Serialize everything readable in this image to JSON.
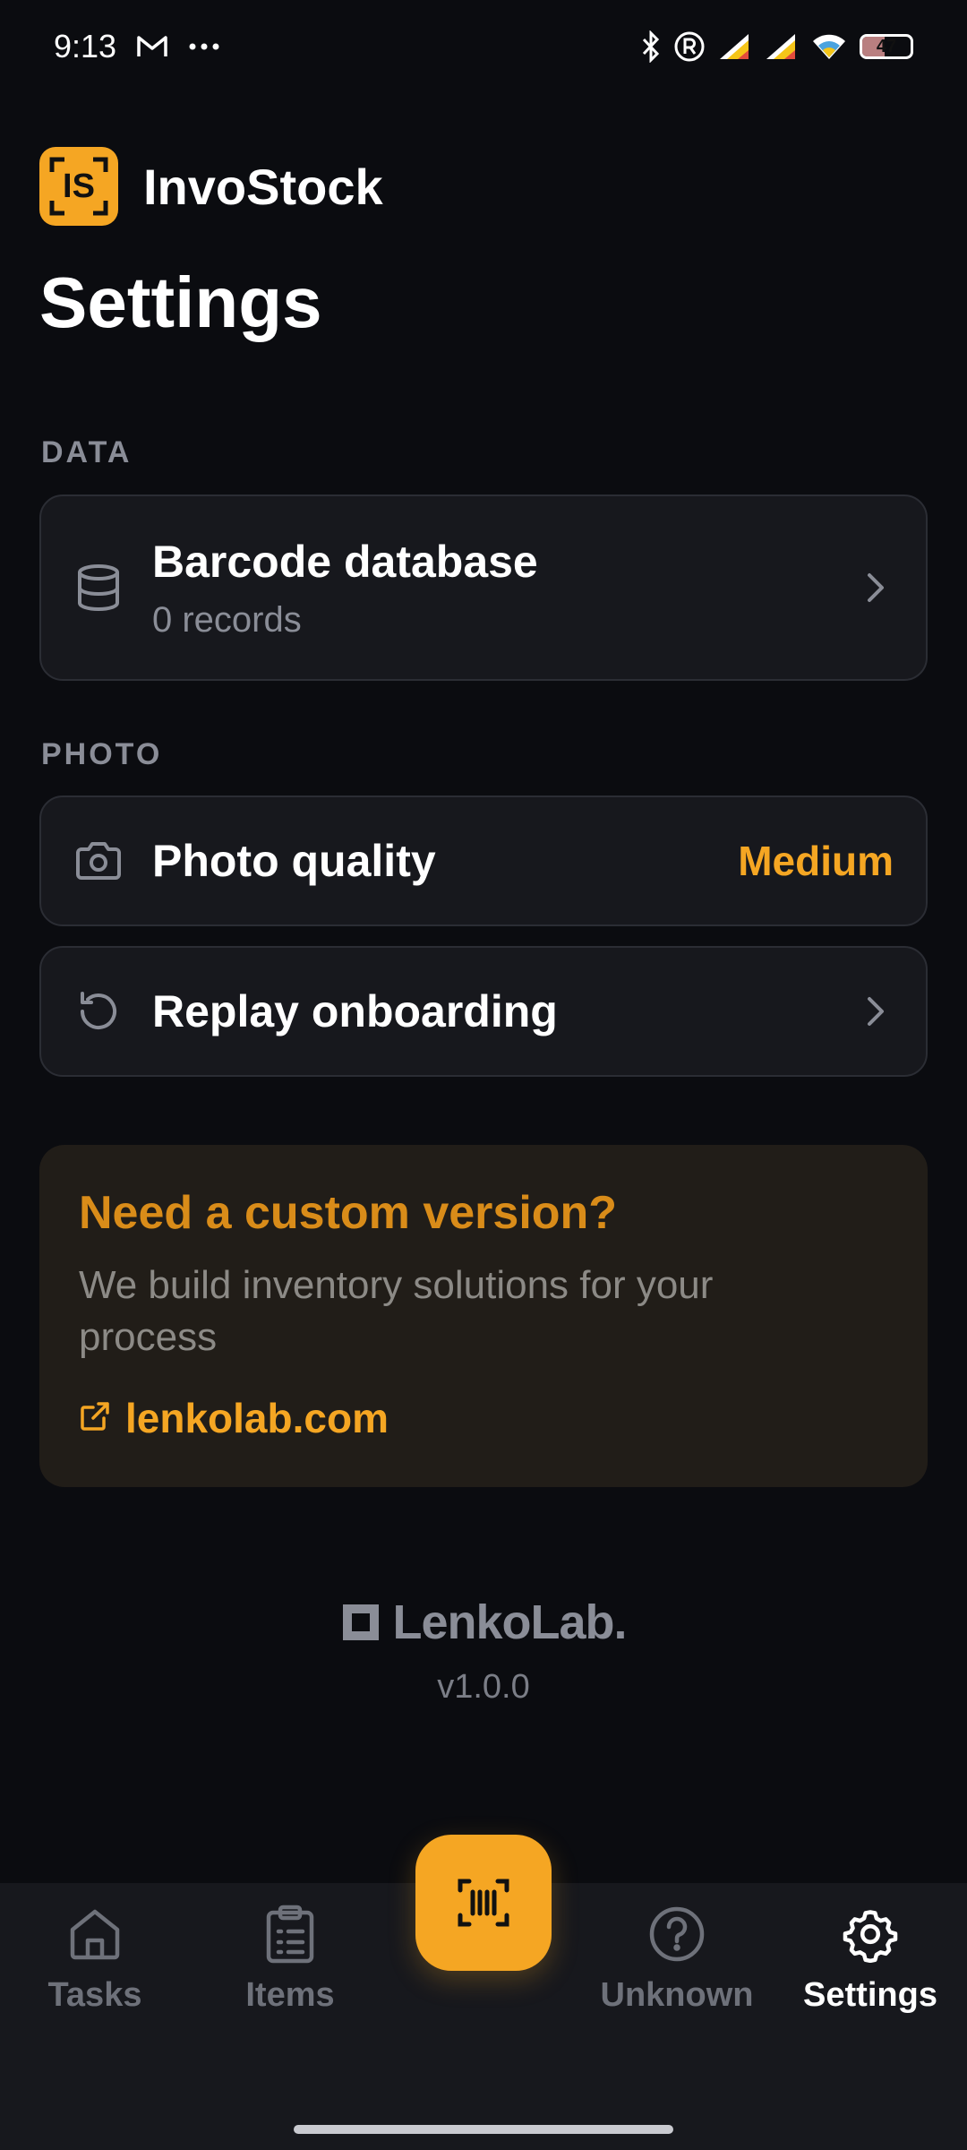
{
  "status_bar": {
    "time": "9:13",
    "battery": "47"
  },
  "app": {
    "name": "InvoStock",
    "logo_text": "IS",
    "accent": "#f5a623"
  },
  "page": {
    "title": "Settings"
  },
  "sections": {
    "data": {
      "label": "DATA",
      "barcode": {
        "title": "Barcode database",
        "subtitle": "0 records",
        "icon": "database-icon"
      }
    },
    "photo": {
      "label": "PHOTO",
      "quality": {
        "title": "Photo quality",
        "value": "Medium",
        "icon": "camera-icon"
      },
      "onboarding": {
        "title": "Replay onboarding",
        "icon": "refresh-icon"
      }
    }
  },
  "promo": {
    "title": "Need a custom version?",
    "description": "We build inventory solutions for your process",
    "link": "lenkolab.com"
  },
  "footer": {
    "brand": "LenkoLab.",
    "version": "v1.0.0"
  },
  "nav": {
    "tasks": "Tasks",
    "items": "Items",
    "unknown": "Unknown",
    "settings": "Settings",
    "active": "settings"
  }
}
